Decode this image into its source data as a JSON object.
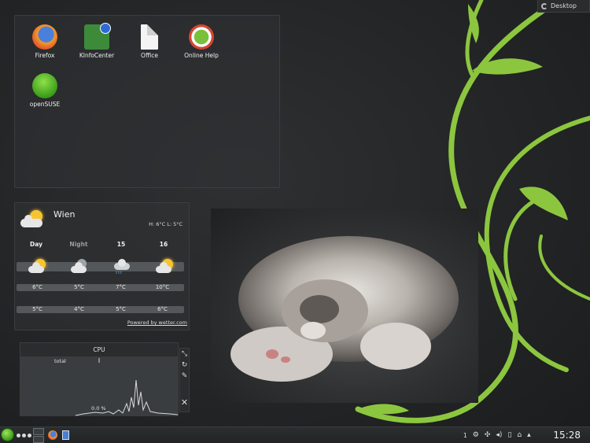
{
  "desktop_button": {
    "label": "Desktop"
  },
  "folder_view": {
    "icons": [
      {
        "label": "Firefox",
        "icon": "firefox-icon"
      },
      {
        "label": "KInfoCenter",
        "icon": "kinfocenter-icon"
      },
      {
        "label": "Office",
        "icon": "office-document-icon"
      },
      {
        "label": "Online Help",
        "icon": "online-help-icon"
      },
      {
        "label": "openSUSE",
        "icon": "opensuse-icon"
      }
    ]
  },
  "weather": {
    "city": "Wien",
    "high_low": "H: 6°C  L: 5°C",
    "days": [
      "Day",
      "Night",
      "15",
      "16"
    ],
    "highs": [
      "6°C",
      "5°C",
      "7°C",
      "10°C"
    ],
    "lows": [
      "5°C",
      "4°C",
      "5°C",
      "6°C"
    ],
    "link": "Powered by wetter.com"
  },
  "cpu": {
    "title": "CPU",
    "series_label": "total",
    "value": "0.0 %",
    "controls": [
      "resize-icon",
      "rotate-icon",
      "wrench-icon",
      "close-icon"
    ],
    "line_color": "#d8dadc"
  },
  "taskbar": {
    "tray_count": "1",
    "clock": "15:28"
  },
  "colors": {
    "accent_green": "#8cc63f"
  }
}
